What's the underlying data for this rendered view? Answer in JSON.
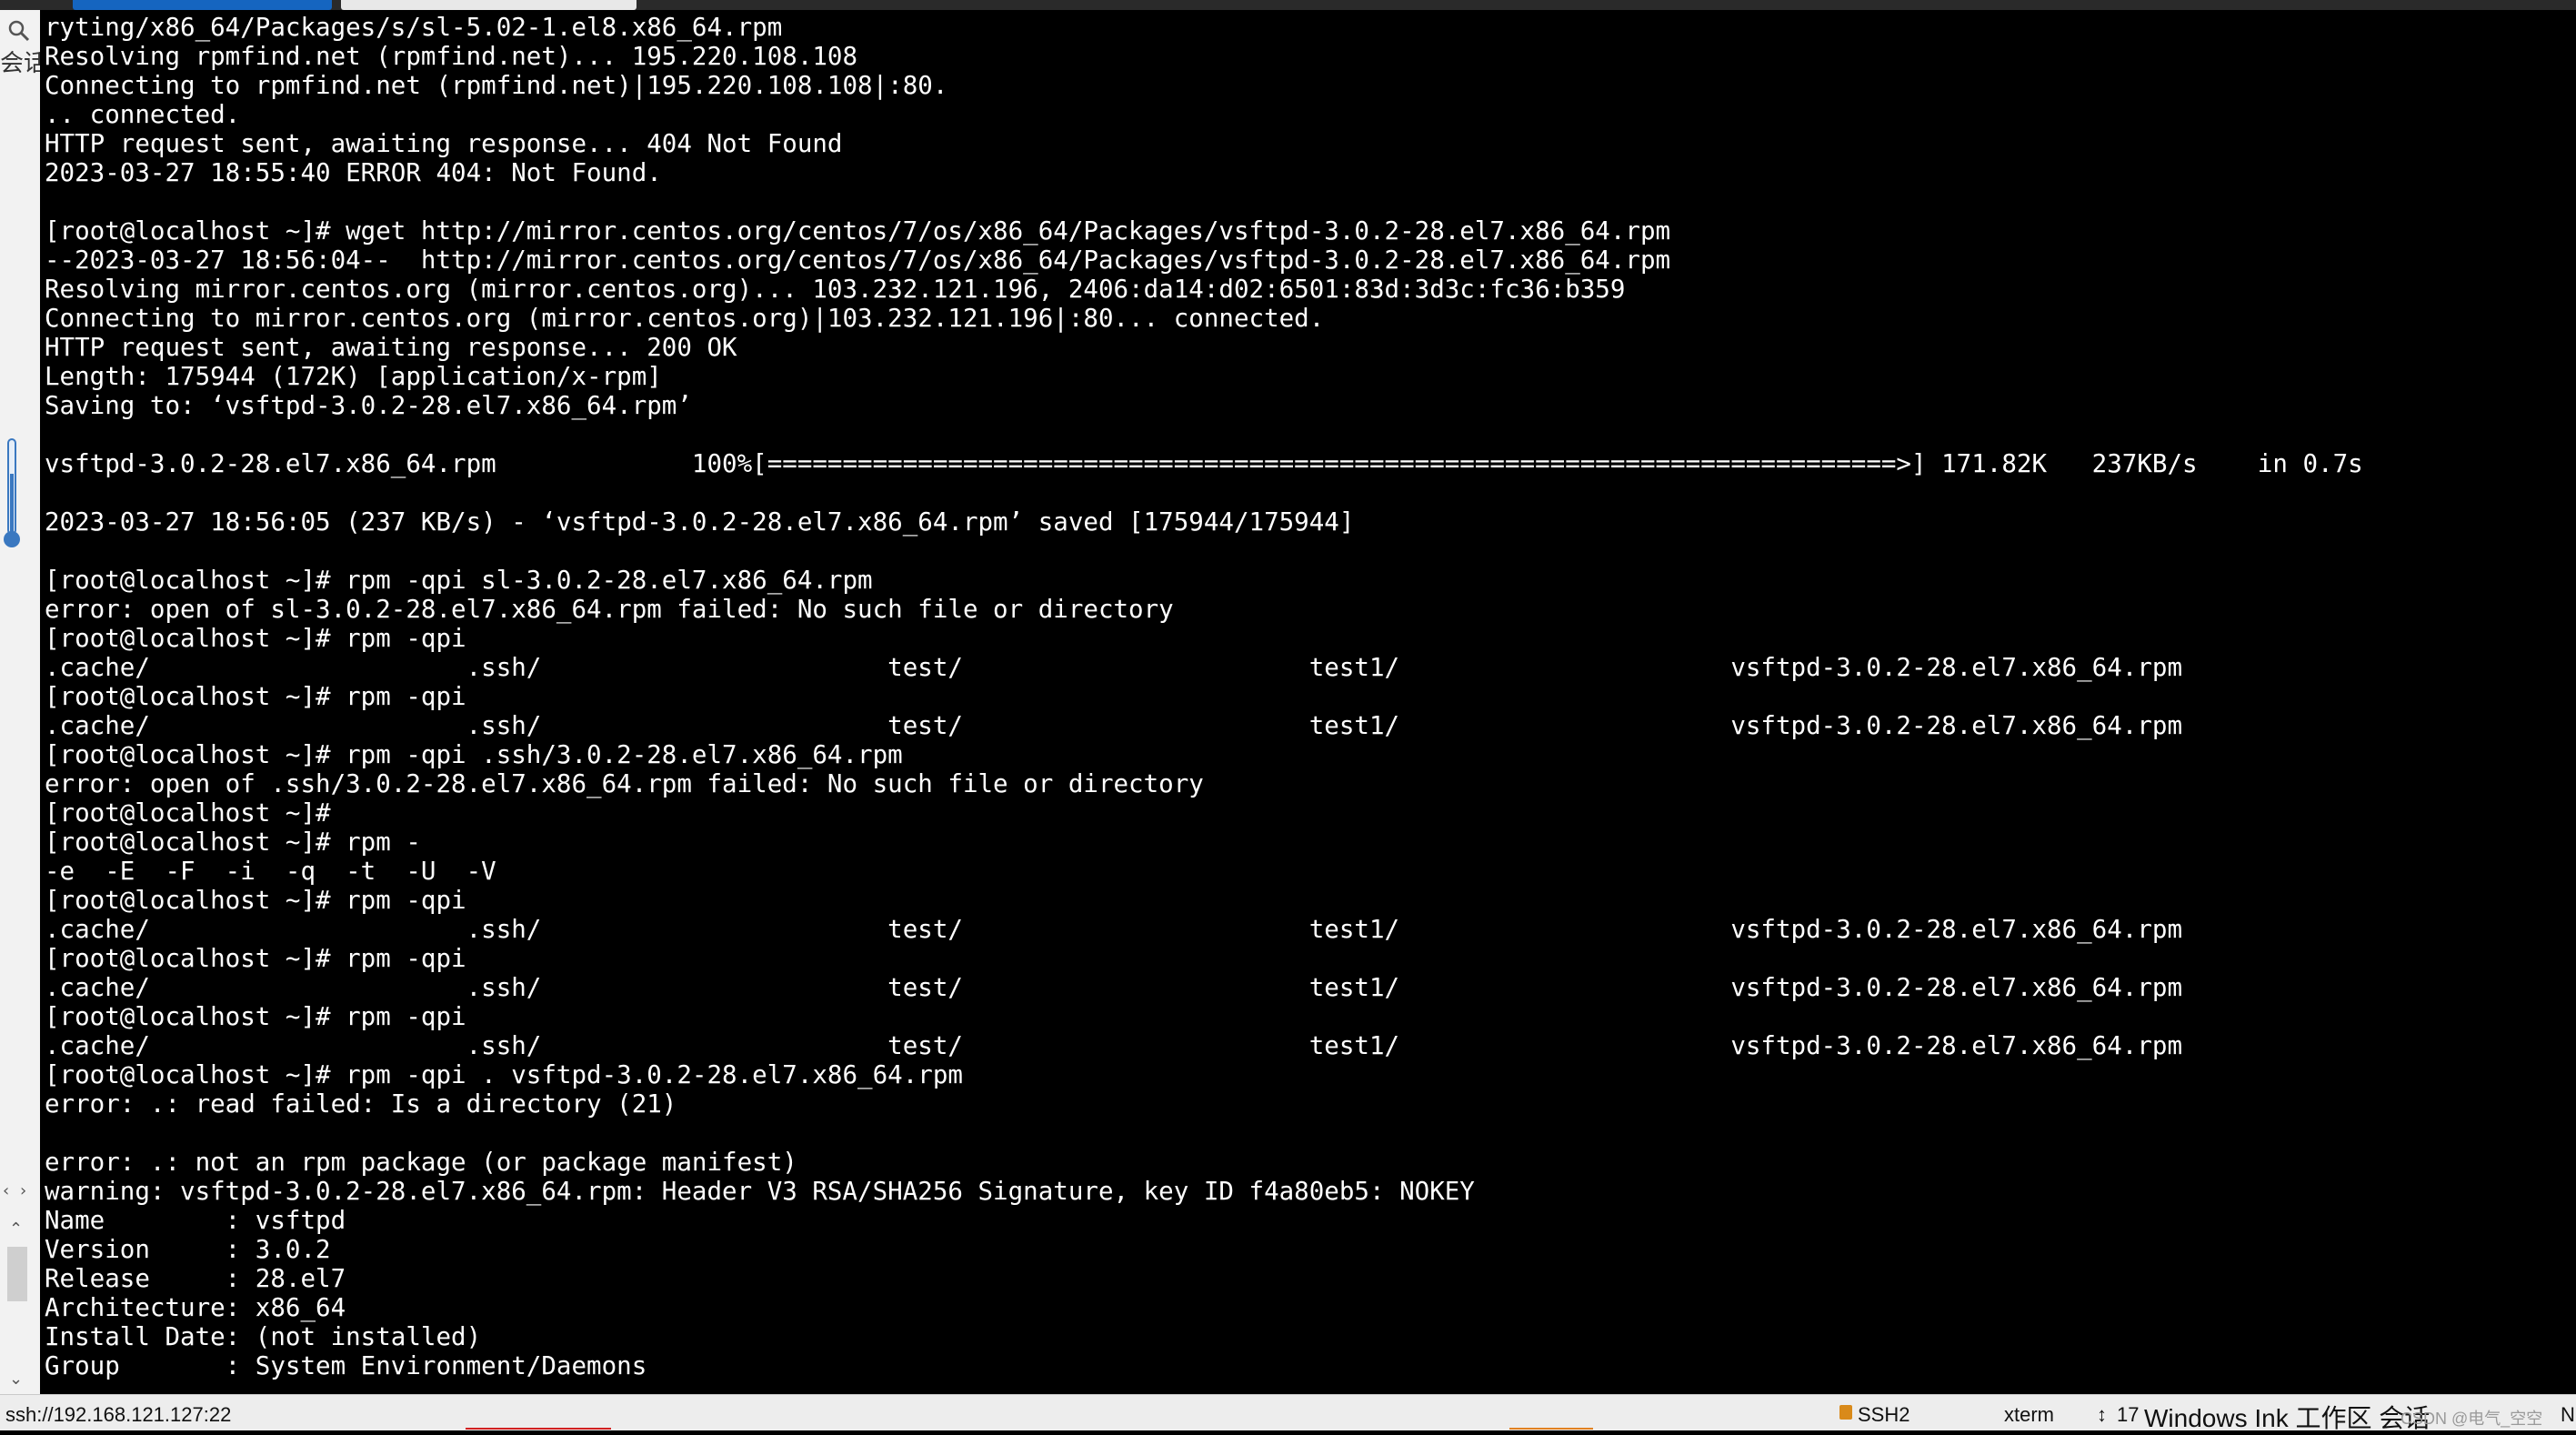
{
  "terminal": {
    "lines": [
      "ryting/x86_64/Packages/s/sl-5.02-1.el8.x86_64.rpm",
      "Resolving rpmfind.net (rpmfind.net)... 195.220.108.108",
      "Connecting to rpmfind.net (rpmfind.net)|195.220.108.108|:80.",
      ".. connected.",
      "HTTP request sent, awaiting response... 404 Not Found",
      "2023-03-27 18:55:40 ERROR 404: Not Found.",
      "",
      "[root@localhost ~]# wget http://mirror.centos.org/centos/7/os/x86_64/Packages/vsftpd-3.0.2-28.el7.x86_64.rpm",
      "--2023-03-27 18:56:04--  http://mirror.centos.org/centos/7/os/x86_64/Packages/vsftpd-3.0.2-28.el7.x86_64.rpm",
      "Resolving mirror.centos.org (mirror.centos.org)... 103.232.121.196, 2406:da14:d02:6501:83d:3d3c:fc36:b359",
      "Connecting to mirror.centos.org (mirror.centos.org)|103.232.121.196|:80... connected.",
      "HTTP request sent, awaiting response... 200 OK",
      "Length: 175944 (172K) [application/x-rpm]",
      "Saving to: ‘vsftpd-3.0.2-28.el7.x86_64.rpm’",
      "",
      "vsftpd-3.0.2-28.el7.x86_64.rpm             100%[===========================================================================>] 171.82K   237KB/s    in 0.7s",
      "",
      "2023-03-27 18:56:05 (237 KB/s) - ‘vsftpd-3.0.2-28.el7.x86_64.rpm’ saved [175944/175944]",
      "",
      "[root@localhost ~]# rpm -qpi sl-3.0.2-28.el7.x86_64.rpm",
      "error: open of sl-3.0.2-28.el7.x86_64.rpm failed: No such file or directory",
      "[root@localhost ~]# rpm -qpi",
      ".cache/                     .ssh/                       test/                       test1/                      vsftpd-3.0.2-28.el7.x86_64.rpm",
      "[root@localhost ~]# rpm -qpi",
      ".cache/                     .ssh/                       test/                       test1/                      vsftpd-3.0.2-28.el7.x86_64.rpm",
      "[root@localhost ~]# rpm -qpi .ssh/3.0.2-28.el7.x86_64.rpm",
      "error: open of .ssh/3.0.2-28.el7.x86_64.rpm failed: No such file or directory",
      "[root@localhost ~]#",
      "[root@localhost ~]# rpm -",
      "-e  -E  -F  -i  -q  -t  -U  -V",
      "[root@localhost ~]# rpm -qpi",
      ".cache/                     .ssh/                       test/                       test1/                      vsftpd-3.0.2-28.el7.x86_64.rpm",
      "[root@localhost ~]# rpm -qpi",
      ".cache/                     .ssh/                       test/                       test1/                      vsftpd-3.0.2-28.el7.x86_64.rpm",
      "[root@localhost ~]# rpm -qpi",
      ".cache/                     .ssh/                       test/                       test1/                      vsftpd-3.0.2-28.el7.x86_64.rpm",
      "[root@localhost ~]# rpm -qpi . vsftpd-3.0.2-28.el7.x86_64.rpm",
      "error: .: read failed: Is a directory (21)",
      "",
      "error: .: not an rpm package (or package manifest)",
      "warning: vsftpd-3.0.2-28.el7.x86_64.rpm: Header V3 RSA/SHA256 Signature, key ID f4a80eb5: NOKEY",
      "Name        : vsftpd",
      "Version     : 3.0.2",
      "Release     : 28.el7",
      "Architecture: x86_64",
      "Install Date: (not installed)",
      "Group       : System Environment/Daemons"
    ]
  },
  "sidebar": {
    "label": "会话",
    "icons": {
      "search": "search-icon",
      "thermometer": "thermometer-icon"
    },
    "arrows": {
      "prev": "‹",
      "next": "›",
      "up": "⌃",
      "down": "⌄"
    }
  },
  "statusbar": {
    "connection": "ssh://192.168.121.127:22",
    "protocol": "SSH2",
    "terminal_type": "xterm",
    "size_icon": "↕",
    "size_prefix": "17",
    "watermark": "Windows Ink 工作区 会话",
    "csdn": "CSDN @电气_空空",
    "tail": "N"
  },
  "colors": {
    "terminal_bg": "#000000",
    "terminal_fg": "#ffffff",
    "tab_active": "#1565c0",
    "statusbar_bg": "#ededed"
  }
}
